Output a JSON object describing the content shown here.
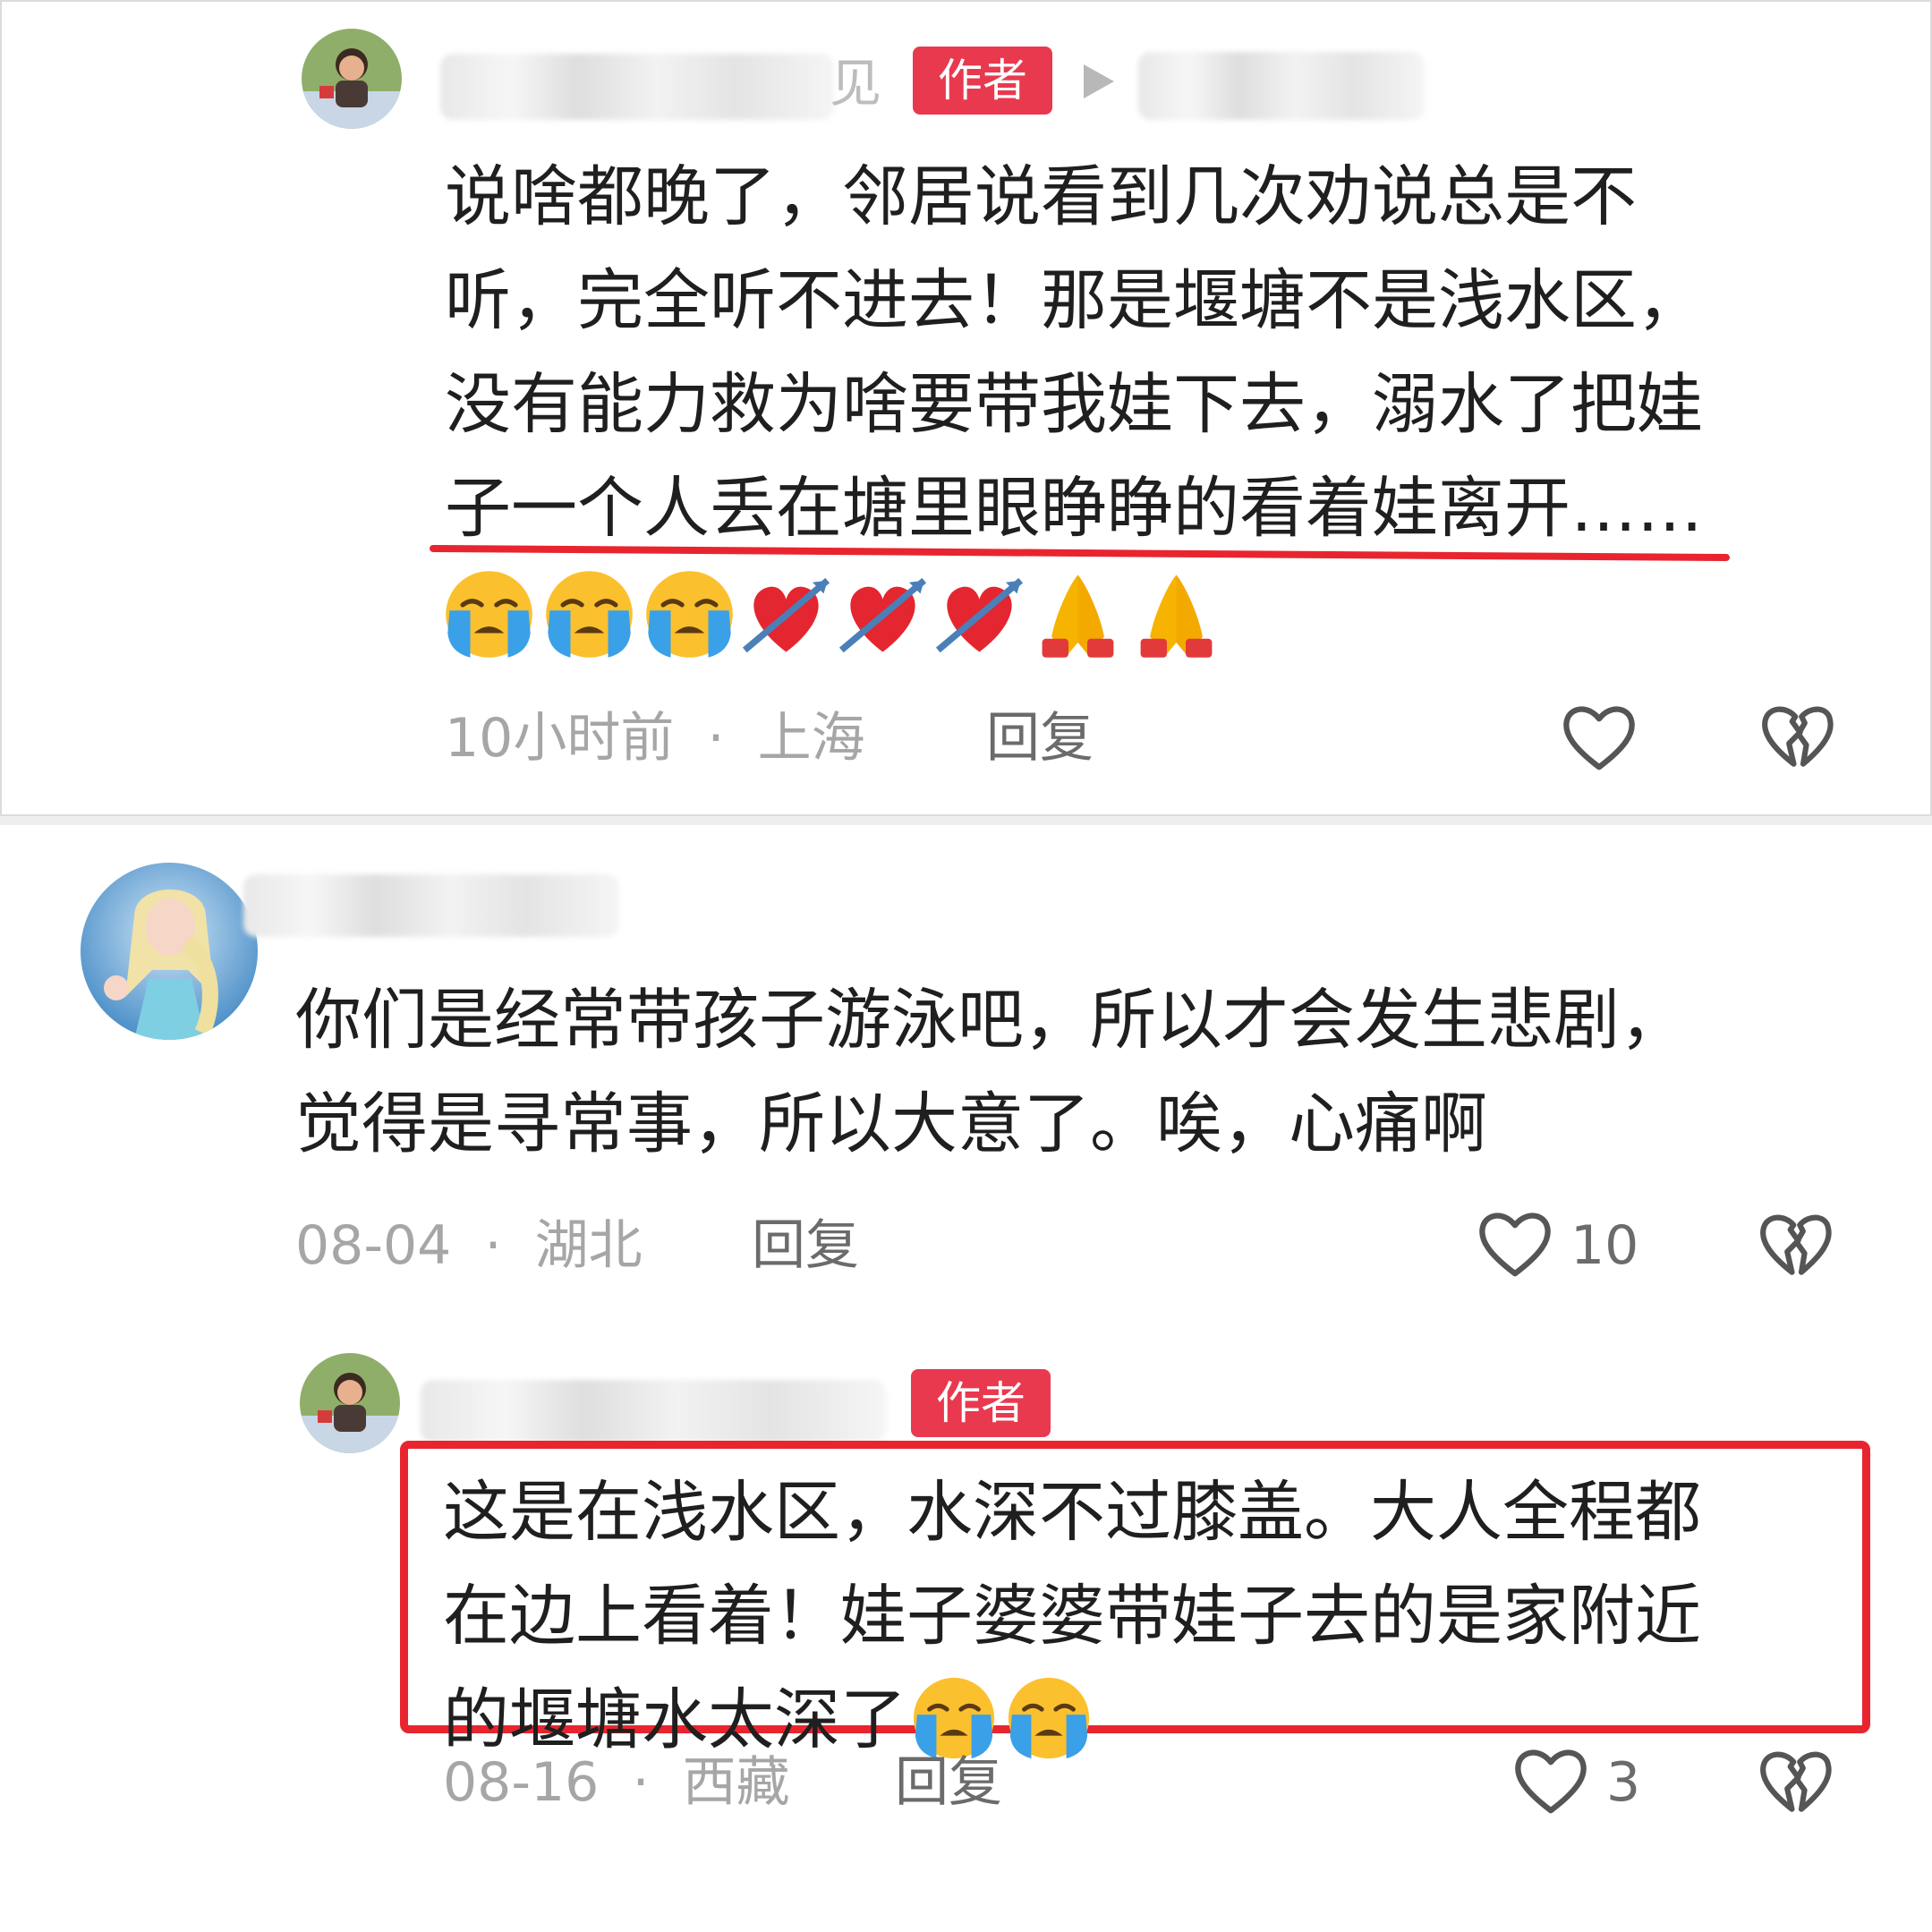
{
  "comments": [
    {
      "author_visible_char": "见",
      "badge": "作者",
      "lines": [
        "说啥都晚了，邻居说看到几次劝说总是不",
        "听，完全听不进去！那是堰塘不是浅水区，",
        "没有能力救为啥要带我娃下去，溺水了把娃",
        "子一个人丢在塘里眼睁睁的看着娃离开……"
      ],
      "emojis": [
        "loudly-crying-face",
        "loudly-crying-face",
        "loudly-crying-face",
        "heart-with-arrow",
        "heart-with-arrow",
        "heart-with-arrow",
        "folded-hands",
        "folded-hands"
      ],
      "time": "10小时前",
      "location": "上海",
      "reply_label": "回复",
      "likes": ""
    },
    {
      "author_visible_char": "",
      "badge": "",
      "lines": [
        "你们是经常带孩子游泳吧，所以才会发生悲剧，",
        "觉得是寻常事，所以大意了。唉，心痛啊"
      ],
      "time": "08-04",
      "location": "湖北",
      "reply_label": "回复",
      "likes": "10"
    },
    {
      "author_visible_char": "",
      "badge": "作者",
      "lines": [
        "这是在浅水区，水深不过膝盖。大人全程都",
        "在边上看着！娃子婆婆带娃子去的是家附近",
        "的堰塘水太深了"
      ],
      "emojis": [
        "loudly-crying-face",
        "loudly-crying-face"
      ],
      "time": "08-16",
      "location": "西藏",
      "reply_label": "回复",
      "likes": "3"
    }
  ],
  "separator": "·",
  "colors": {
    "badge": "#e9394f",
    "highlight": "#e8252f",
    "text": "#1f1f1f",
    "meta": "#a6a6a6"
  },
  "icons": [
    "like-heart-icon",
    "dislike-broken-heart-icon",
    "play-arrow-icon"
  ]
}
